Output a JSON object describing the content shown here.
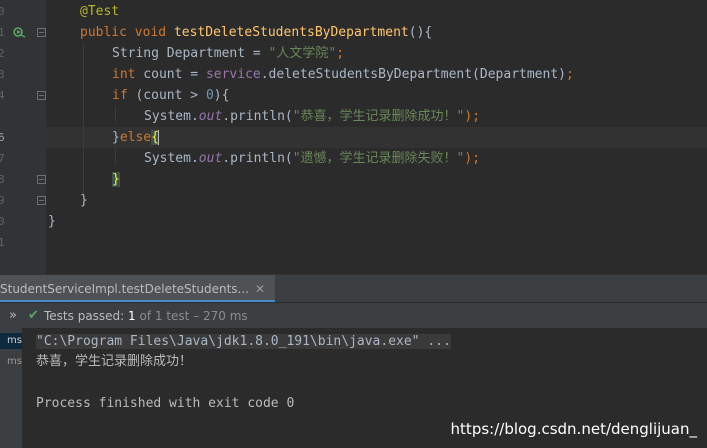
{
  "editor": {
    "line_numbers": [
      "0",
      "1",
      "2",
      "3",
      "4",
      "5",
      "6",
      "7",
      "8",
      "9",
      "0",
      "1"
    ],
    "lines": {
      "l0": {
        "annotation": "@Test"
      },
      "l1": {
        "kw_public": "public",
        "kw_void": "void",
        "method": "testDeleteStudentsByDepartment",
        "tail": "(){"
      },
      "l2": {
        "type": "String Department = ",
        "str": "\"人文学院\"",
        "semi": ";"
      },
      "l3": {
        "kw_int": "int",
        "mid": " count = ",
        "field": "service",
        "call": ".deleteStudentsByDepartment(Department)",
        "semi": ";"
      },
      "l4": {
        "kw_if": "if",
        "cond": " (count > ",
        "num": "0",
        "tail": "){"
      },
      "l5": {
        "sys": "System.",
        "out": "out",
        "println": ".println(",
        "str": "\"恭喜，学生记录删除成功！\"",
        "tail": ");"
      },
      "l6": {
        "close": "}",
        "kw_else": "else",
        "brace": "{"
      },
      "l7": {
        "sys": "System.",
        "out": "out",
        "println": ".println(",
        "str": "\"遗憾，学生记录删除失败！\"",
        "tail": ");"
      },
      "l8": {
        "brace": "}"
      },
      "l9": {
        "brace": "}"
      },
      "l10": {
        "brace": "}"
      }
    }
  },
  "run_panel": {
    "tab_title": "StudentServiceImpl.testDeleteStudents...",
    "tab_close": "✕",
    "tests_passed_label": "Tests passed:",
    "tests_passed_count": "1",
    "tests_passed_detail": "of 1 test – 270 ms",
    "expand_icon_glyph": "»",
    "check_icon_glyph": "✔",
    "time_labels": [
      "ms",
      "ms"
    ]
  },
  "console": {
    "command": "\"C:\\Program Files\\Java\\jdk1.8.0_191\\bin\\java.exe\" ...",
    "output_1": "恭喜，学生记录删除成功！",
    "output_2": "Process finished with exit code 0"
  },
  "watermark": "https://blog.csdn.net/denglijuan_",
  "colors": {
    "background": "#2b2b2b",
    "keyword": "#cc7832",
    "string": "#6a8759",
    "method": "#ffc66d",
    "pass_green": "#59a869"
  }
}
